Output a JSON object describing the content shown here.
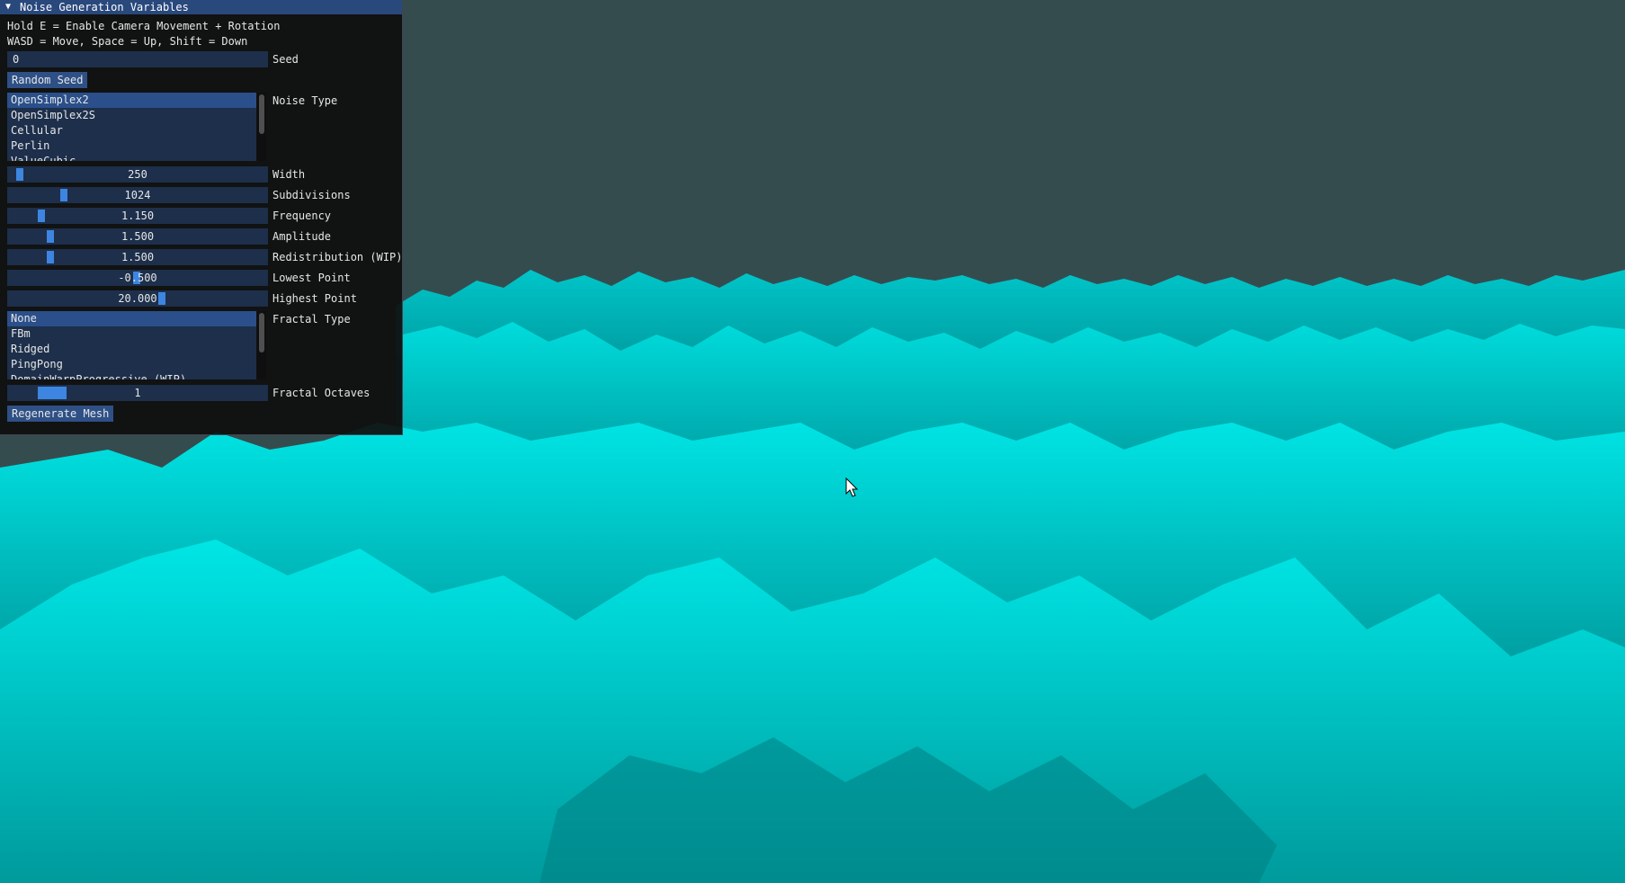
{
  "window": {
    "title": "Noise Generation Variables",
    "help_line1": "Hold E = Enable Camera Movement + Rotation",
    "help_line2": "WASD = Move, Space = Up, Shift = Down"
  },
  "seed": {
    "value": "0",
    "label": "Seed"
  },
  "random_seed_button": "Random Seed",
  "noise_type": {
    "label": "Noise Type",
    "options": [
      "OpenSimplex2",
      "OpenSimplex2S",
      "Cellular",
      "Perlin",
      "ValueCubic"
    ],
    "selected": "OpenSimplex2"
  },
  "sliders": {
    "width": {
      "value": "250",
      "label": "Width"
    },
    "subdivisions": {
      "value": "1024",
      "label": "Subdivisions"
    },
    "frequency": {
      "value": "1.150",
      "label": "Frequency"
    },
    "amplitude": {
      "value": "1.500",
      "label": "Amplitude"
    },
    "redistribution": {
      "value": "1.500",
      "label": "Redistribution (WIP)"
    },
    "lowest_point": {
      "value": "-0.500",
      "label": "Lowest Point"
    },
    "highest_point": {
      "value": "20.000",
      "label": "Highest Point"
    }
  },
  "fractal_type": {
    "label": "Fractal Type",
    "options": [
      "None",
      "FBm",
      "Ridged",
      "PingPong",
      "DomainWarpProgressive (WIP)"
    ],
    "selected": "None"
  },
  "fractal_octaves": {
    "value": "1",
    "label": "Fractal Octaves"
  },
  "regenerate_button": "Regenerate Mesh",
  "colors": {
    "sky": "#354c4f",
    "terrain_light": "#00e0e0",
    "terrain_dark": "#005a60",
    "title_bar": "#29487c",
    "frame_bg": "#1d2f4b",
    "slider_grab": "#3d85e0",
    "button": "#2e5086"
  },
  "icons": {
    "collapse": "triangle-down-icon",
    "cursor": "mouse-pointer-icon"
  }
}
